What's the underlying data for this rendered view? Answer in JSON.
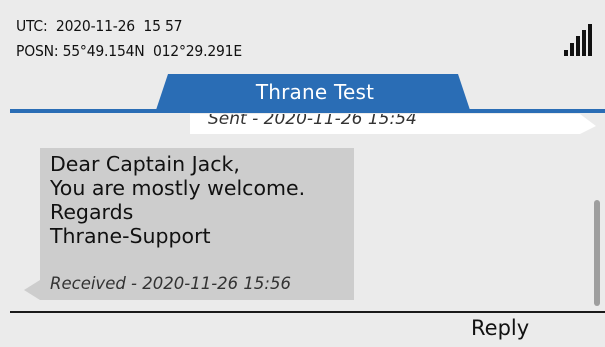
{
  "status": {
    "utc": "UTC:  2020-11-26  15 57",
    "posn": "POSN: 55°49.154N  012°29.291E",
    "signal_icon": "signal-strength-icon"
  },
  "conversation": {
    "title": "Thrane Test"
  },
  "messages": {
    "sent": {
      "meta": "Sent - 2020-11-26 15:54"
    },
    "received": {
      "lines": [
        "Dear Captain Jack,",
        "You are mostly welcome.",
        "Regards",
        "Thrane-Support"
      ],
      "meta": "Received - 2020-11-26 15:56"
    }
  },
  "softkeys": {
    "reply": "Reply"
  },
  "colors": {
    "accent": "#2a6db5",
    "background": "#ebebeb",
    "received_bubble": "#cdcdcd",
    "sent_bubble": "#ffffff"
  }
}
